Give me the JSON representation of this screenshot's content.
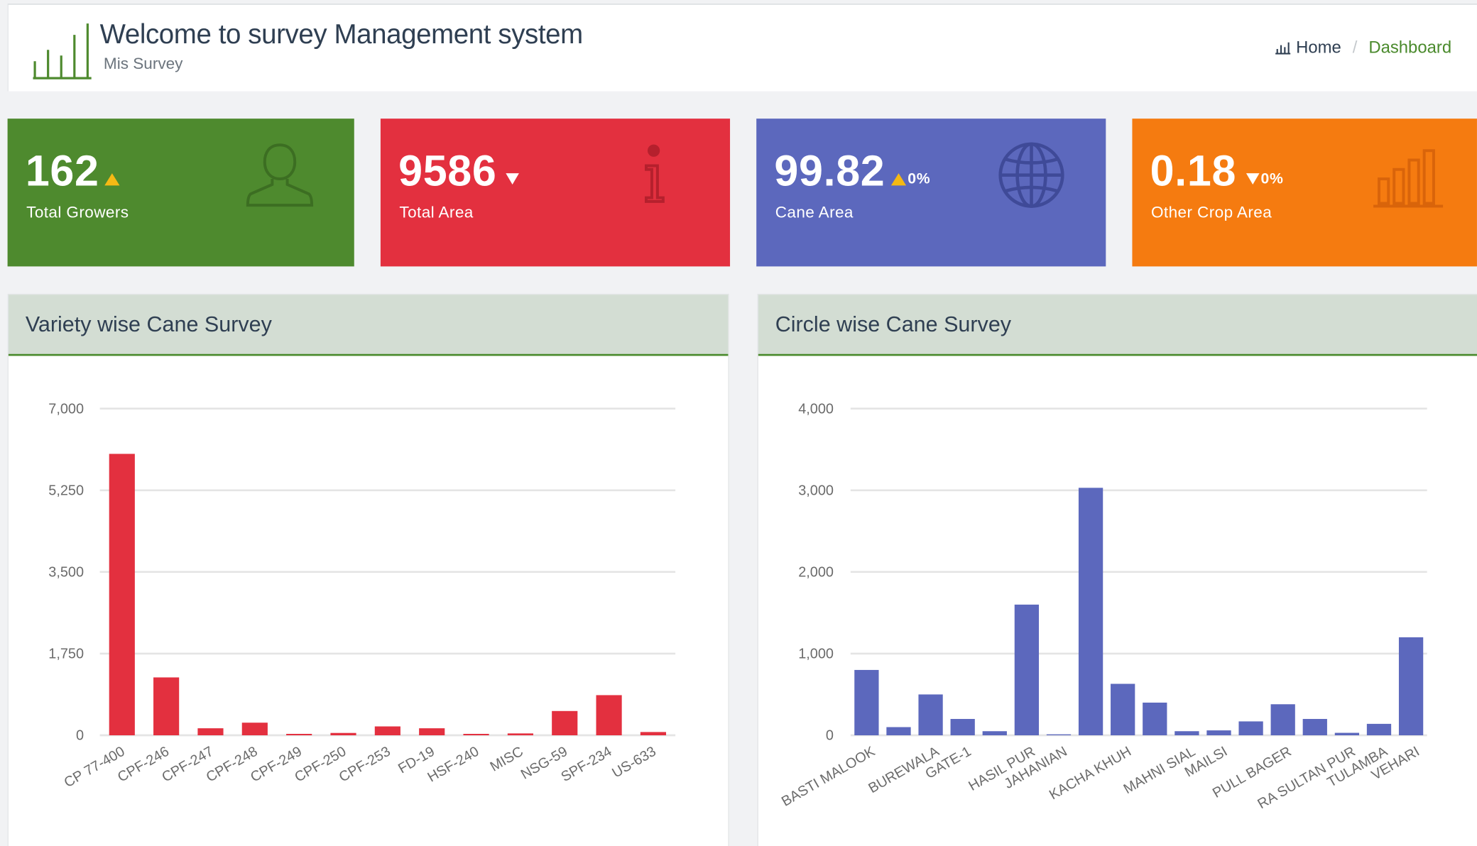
{
  "header": {
    "title": "Welcome to survey Management system",
    "subtitle": "Mis Survey",
    "breadcrumb": {
      "home": "Home",
      "separator": "/",
      "current": "Dashboard"
    }
  },
  "cards": [
    {
      "value": "162",
      "label": "Total Growers",
      "trend": "up",
      "pct": "",
      "color": "#4e8a2e",
      "icon": "user-icon"
    },
    {
      "value": "9586",
      "label": "Total Area",
      "trend": "down",
      "pct": "",
      "color": "#e3303f",
      "icon": "info-icon"
    },
    {
      "value": "99.82",
      "label": "Cane Area",
      "trend": "up",
      "pct": "0%",
      "color": "#5c68bd",
      "icon": "globe-icon"
    },
    {
      "value": "0.18",
      "label": "Other Crop Area",
      "trend": "down",
      "pct": "0%",
      "color": "#f57b10",
      "icon": "bar-chart-icon"
    }
  ],
  "panels": {
    "variety": {
      "title": "Variety wise Cane Survey"
    },
    "circle": {
      "title": "Circle wise Cane Survey"
    }
  },
  "chart_data": [
    {
      "type": "bar",
      "title": "Variety wise Cane Survey",
      "color": "#e3303f",
      "categories": [
        "CP 77-400",
        "CPF-246",
        "CPF-247",
        "CPF-248",
        "CPF-249",
        "CPF-250",
        "CPF-253",
        "FD-19",
        "HSF-240",
        "MISC",
        "NSG-59",
        "SPF-234",
        "US-633"
      ],
      "values": [
        6030,
        1240,
        150,
        270,
        10,
        50,
        190,
        150,
        30,
        40,
        520,
        860,
        70
      ],
      "ylim": [
        0,
        7000
      ],
      "yticks": [
        0,
        1750,
        3500,
        5250,
        7000
      ],
      "yticklabels": [
        "0",
        "1,750",
        "3,500",
        "5,250",
        "7,000"
      ],
      "grid": true
    },
    {
      "type": "bar",
      "title": "Circle wise Cane Survey",
      "color": "#5c68bd",
      "categories": [
        "BASTI MALOOK",
        "BUREWALA",
        "GATE-1",
        "HASIL PUR",
        "JAHANIAN",
        "KACHA KHUH",
        "MAHNI SIAL",
        "MAILSI",
        "PULL BAGER",
        "RA SULTAN PUR",
        "TULAMBA",
        "VEHARI"
      ],
      "all_bars": [
        "BASTI MALOOK",
        "",
        "BUREWALA",
        "GATE-1",
        "",
        "HASIL PUR",
        "JAHANIAN",
        "",
        "KACHA KHUH",
        "",
        "MAHNI SIAL",
        "MAILSI",
        "",
        "PULL BAGER",
        "",
        "RA SULTAN PUR",
        "TULAMBA",
        "VEHARI"
      ],
      "values": [
        800,
        100,
        500,
        200,
        50,
        1600,
        0,
        3030,
        630,
        400,
        50,
        60,
        170,
        380,
        200,
        30,
        140,
        1200
      ],
      "ylim": [
        0,
        4000
      ],
      "yticks": [
        0,
        1000,
        2000,
        3000,
        4000
      ],
      "yticklabels": [
        "0",
        "1,000",
        "2,000",
        "3,000",
        "4,000"
      ],
      "grid": true
    }
  ]
}
